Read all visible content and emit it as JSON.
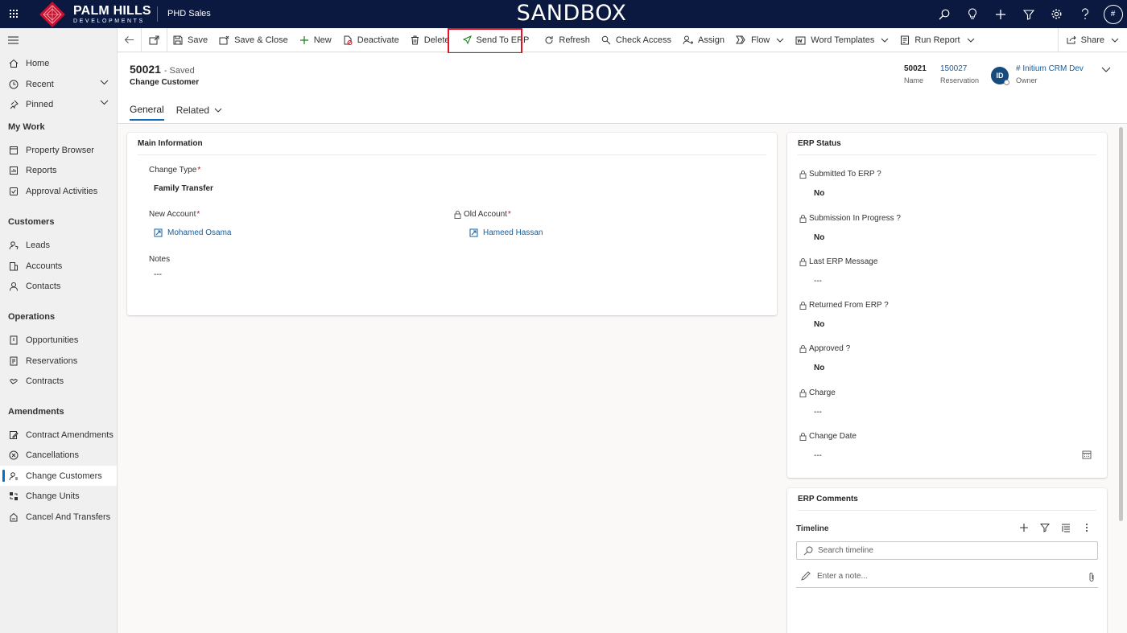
{
  "topbar": {
    "logo_main": "PALM HILLS",
    "logo_sub": "DEVELOPMENTS",
    "app_name": "PHD Sales",
    "environment": "SANDBOX",
    "user_initials": "#"
  },
  "sidebar": {
    "items": [
      {
        "label": "Home",
        "icon": "home-icon"
      },
      {
        "label": "Recent",
        "icon": "clock-icon",
        "expandable": true
      },
      {
        "label": "Pinned",
        "icon": "pin-icon",
        "expandable": true
      }
    ],
    "groups": [
      {
        "title": "My Work",
        "items": [
          {
            "label": "Property Browser",
            "icon": "browser-icon"
          },
          {
            "label": "Reports",
            "icon": "report-icon"
          },
          {
            "label": "Approval Activities",
            "icon": "approval-icon"
          }
        ]
      },
      {
        "title": "Customers",
        "items": [
          {
            "label": "Leads",
            "icon": "phone-person-icon"
          },
          {
            "label": "Accounts",
            "icon": "building-icon"
          },
          {
            "label": "Contacts",
            "icon": "person-icon"
          }
        ]
      },
      {
        "title": "Operations",
        "items": [
          {
            "label": "Opportunities",
            "icon": "opportunity-icon"
          },
          {
            "label": "Reservations",
            "icon": "reservation-icon"
          },
          {
            "label": "Contracts",
            "icon": "handshake-icon"
          }
        ]
      },
      {
        "title": "Amendments",
        "items": [
          {
            "label": "Contract Amendments",
            "icon": "edit-doc-icon"
          },
          {
            "label": "Cancellations",
            "icon": "cancel-circle-icon"
          },
          {
            "label": "Change Customers",
            "icon": "person-swap-icon",
            "active": true
          },
          {
            "label": "Change Units",
            "icon": "unit-swap-icon"
          },
          {
            "label": "Cancel And Transfers",
            "icon": "transfer-icon"
          }
        ]
      }
    ]
  },
  "commandbar": {
    "save": "Save",
    "save_close": "Save & Close",
    "new": "New",
    "deactivate": "Deactivate",
    "delete": "Delete",
    "send_to_erp": "Send To ERP",
    "refresh": "Refresh",
    "check_access": "Check Access",
    "assign": "Assign",
    "flow": "Flow",
    "word_templates": "Word Templates",
    "run_report": "Run Report",
    "share": "Share"
  },
  "record": {
    "name": "50021",
    "status": "- Saved",
    "entity": "Change Customer",
    "header_fields": {
      "name_value": "50021",
      "name_label": "Name",
      "reservation_value": "150027",
      "reservation_label": "Reservation",
      "owner_initials": "ID",
      "owner_value": "# Initium CRM Dev",
      "owner_label": "Owner"
    },
    "tabs": {
      "general": "General",
      "related": "Related"
    }
  },
  "main_info": {
    "title": "Main Information",
    "change_type_label": "Change Type",
    "change_type_value": "Family Transfer",
    "new_account_label": "New Account",
    "new_account_value": "Mohamed Osama",
    "old_account_label": "Old Account",
    "old_account_value": "Hameed Hassan",
    "notes_label": "Notes",
    "notes_value": "---"
  },
  "erp_status": {
    "title": "ERP Status",
    "fields": [
      {
        "label": "Submitted To ERP ?",
        "value": "No"
      },
      {
        "label": "Submission In Progress ?",
        "value": "No"
      },
      {
        "label": "Last ERP Message",
        "value": "---"
      },
      {
        "label": "Returned From ERP ?",
        "value": "No"
      },
      {
        "label": "Approved ?",
        "value": "No"
      },
      {
        "label": "Charge",
        "value": "---"
      },
      {
        "label": "Change Date",
        "value": "---"
      }
    ]
  },
  "erp_comments": {
    "title": "ERP Comments",
    "timeline_label": "Timeline",
    "search_placeholder": "Search timeline",
    "note_placeholder": "Enter a note..."
  }
}
